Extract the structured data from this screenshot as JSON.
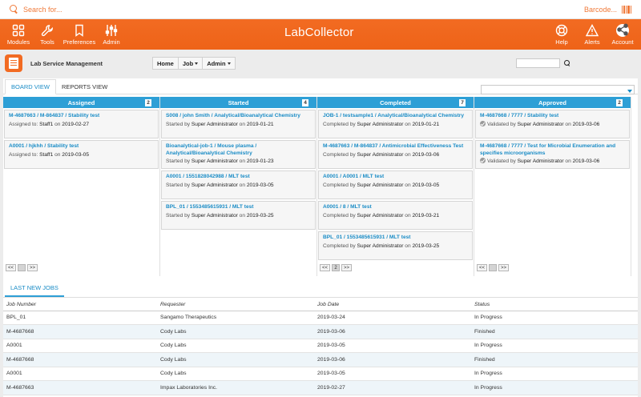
{
  "topbar": {
    "search_placeholder": "Search for...",
    "barcode_label": "Barcode..."
  },
  "nav": {
    "left": [
      {
        "label": "Modules",
        "icon": "grid-icon"
      },
      {
        "label": "Tools",
        "icon": "wrench-icon"
      },
      {
        "label": "Preferences",
        "icon": "bookmark-icon"
      },
      {
        "label": "Admin",
        "icon": "sliders-icon"
      }
    ],
    "logo": "LabCollector",
    "right": [
      {
        "label": "Help",
        "icon": "lifebuoy-icon"
      },
      {
        "label": "Alerts",
        "icon": "warning-icon"
      },
      {
        "label": "Account",
        "icon": "share-icon"
      }
    ]
  },
  "subheader": {
    "title": "Lab Service Management",
    "menu": [
      {
        "label": "Home"
      },
      {
        "label": "Job"
      },
      {
        "label": "Admin"
      }
    ]
  },
  "tabs": [
    {
      "label": "BOARD VIEW"
    },
    {
      "label": "REPORTS VIEW"
    }
  ],
  "board": {
    "columns": [
      {
        "title": "Assigned",
        "count": "2",
        "cards": [
          {
            "title": "M-4687663 / M-864837 / Stability test",
            "prefix": "Assigned to:",
            "who": "Staff1",
            "on": "on",
            "date": "2019-02-27"
          },
          {
            "title": "A0001 / hjkhh / Stability test",
            "prefix": "Assigned to:",
            "who": "Staff1",
            "on": "on",
            "date": "2019-03-05"
          }
        ],
        "pager": {
          "prev": "<<",
          "page": "",
          "next": ">>"
        }
      },
      {
        "title": "Started",
        "count": "4",
        "cards": [
          {
            "title": "S008 / john Smith / Analytical/Bioanalytical Chemistry",
            "prefix": "Started by",
            "who": "Super Administrator",
            "on": "on",
            "date": "2019-01-21"
          },
          {
            "title": "Bioanalytical-job-1 / Mouse plasma / Analytical/Bioanalytical Chemistry",
            "prefix": "Started by",
            "who": "Super Administrator",
            "on": "on",
            "date": "2019-01-23"
          },
          {
            "title": "A0001 / 1551828042988 / MLT test",
            "prefix": "Started by",
            "who": "Super Administrator",
            "on": "on",
            "date": "2019-03-05"
          },
          {
            "title": "BPL_01 / 1553485615931 / MLT test",
            "prefix": "Started by",
            "who": "Super Administrator",
            "on": "on",
            "date": "2019-03-25"
          }
        ],
        "pager": null
      },
      {
        "title": "Completed",
        "count": "7",
        "cards": [
          {
            "title": "JOB-1 / testsample1 / Analytical/Bioanalytical Chemistry",
            "prefix": "Completed by",
            "who": "Super Administrator",
            "on": "on",
            "date": "2019-01-21"
          },
          {
            "title": "M-4687663 / M-864837 / Antimicrobial Effectiveness Test",
            "prefix": "Completed by",
            "who": "Super Administrator",
            "on": "on",
            "date": "2019-03-06"
          },
          {
            "title": "A0001 / A0001 / MLT test",
            "prefix": "Completed by",
            "who": "Super Administrator",
            "on": "on",
            "date": "2019-03-05"
          },
          {
            "title": "A0001 / 8 / MLT test",
            "prefix": "Completed by",
            "who": "Super Administrator",
            "on": "on",
            "date": "2019-03-21"
          },
          {
            "title": "BPL_01 / 1553485615931 / MLT test",
            "prefix": "Completed by",
            "who": "Super Administrator",
            "on": "on",
            "date": "2019-03-25"
          }
        ],
        "pager": {
          "prev": "<<",
          "page": "2",
          "next": ">>"
        }
      },
      {
        "title": "Approved",
        "count": "2",
        "cards": [
          {
            "title": "M-4687668 / 7777 / Stability test",
            "prefix": "Validated by",
            "who": "Super Administrator",
            "on": "on",
            "date": "2019-03-06",
            "check": true
          },
          {
            "title": "M-4687668 / 7777 / Test for Microbial Enumeration and specifies microorganisms",
            "prefix": "Validated by",
            "who": "Super Administrator",
            "on": "on",
            "date": "2019-03-06",
            "check": true
          }
        ],
        "pager": {
          "prev": "<<",
          "page": "",
          "next": ">>"
        }
      }
    ]
  },
  "last_jobs": {
    "tab": "LAST NEW JOBS",
    "headers": [
      "Job Number",
      "Requester",
      "Job Date",
      "Status"
    ],
    "rows": [
      [
        "BPL_01",
        "Sangamo Therapeutics",
        "2019-03-24",
        "In Progress"
      ],
      [
        "M-4687668",
        "Cody Labs",
        "2019-03-06",
        "Finished"
      ],
      [
        "A0001",
        "Cody Labs",
        "2019-03-05",
        "In Progress"
      ],
      [
        "M-4687668",
        "Cody Labs",
        "2019-03-06",
        "Finished"
      ],
      [
        "A0001",
        "Cody Labs",
        "2019-03-05",
        "In Progress"
      ],
      [
        "M-4687663",
        "Impax Laboratories Inc.",
        "2019-02-27",
        "In Progress"
      ]
    ]
  },
  "colors": {
    "brand": "#f26b22",
    "accent": "#2d9fd6",
    "link": "#1a8cc6"
  }
}
